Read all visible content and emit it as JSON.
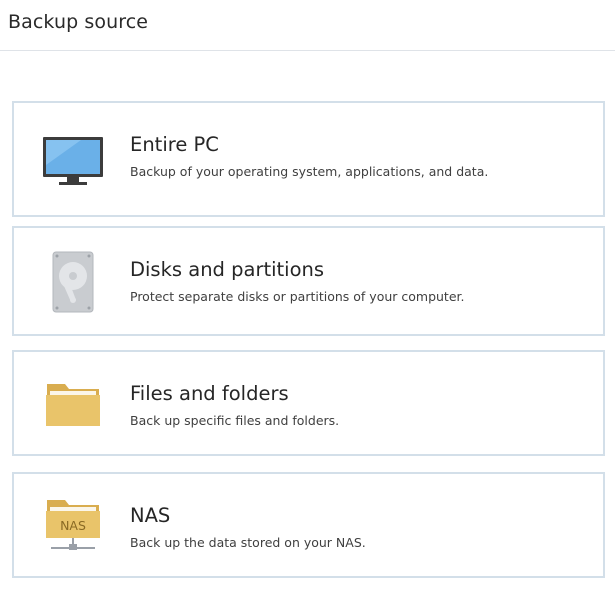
{
  "header": {
    "title": "Backup source"
  },
  "options": [
    {
      "title": "Entire PC",
      "description": "Backup of your operating system, applications, and data.",
      "icon": "monitor-icon"
    },
    {
      "title": "Disks and partitions",
      "description": "Protect separate disks or partitions of your computer.",
      "icon": "hard-disk-icon"
    },
    {
      "title": "Files and folders",
      "description": "Back up specific files and folders.",
      "icon": "folder-icon"
    },
    {
      "title": "NAS",
      "description": "Back up the data stored on your NAS.",
      "icon": "nas-folder-icon",
      "icon_label": "NAS"
    }
  ],
  "colors": {
    "card_border": "#d3dfe9",
    "monitor_screen": "#6ab0e8",
    "folder": "#e9c46a",
    "disk": "#c9ccd0"
  }
}
